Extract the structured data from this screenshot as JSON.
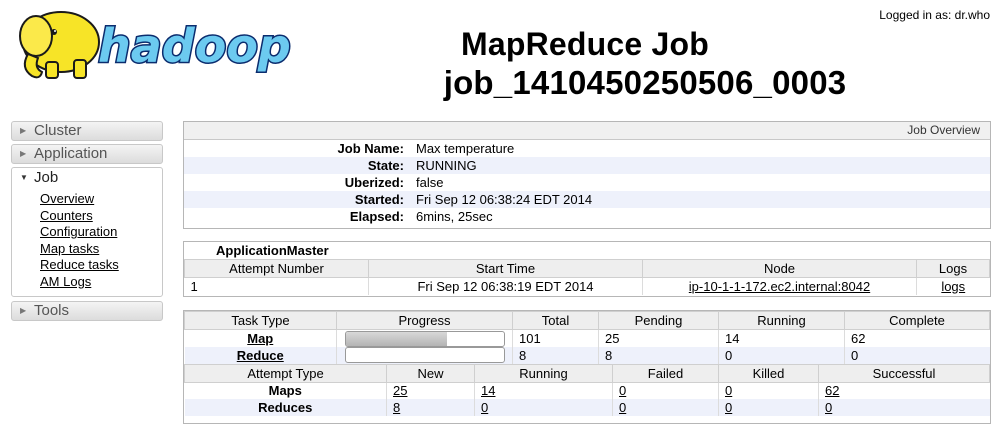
{
  "header": {
    "logged_in": "Logged in as: dr.who",
    "title_line1": "MapReduce Job",
    "title_line2": "job_1410450250506_0003",
    "logo_text": "hadoop"
  },
  "sidebar": {
    "cluster": "Cluster",
    "application": "Application",
    "job": "Job",
    "job_links": [
      "Overview",
      "Counters",
      "Configuration",
      "Map tasks",
      "Reduce tasks",
      "AM Logs"
    ],
    "tools": "Tools"
  },
  "job_overview": {
    "caption": "Job Overview",
    "rows": [
      {
        "label": "Job Name:",
        "value": "Max temperature"
      },
      {
        "label": "State:",
        "value": "RUNNING"
      },
      {
        "label": "Uberized:",
        "value": "false"
      },
      {
        "label": "Started:",
        "value": "Fri Sep 12 06:38:24 EDT 2014"
      },
      {
        "label": "Elapsed:",
        "value": "6mins, 25sec"
      }
    ]
  },
  "app_master": {
    "caption": "ApplicationMaster",
    "headers": [
      "Attempt Number",
      "Start Time",
      "Node",
      "Logs"
    ],
    "row": {
      "attempt": "1",
      "start_time": "Fri Sep 12 06:38:19 EDT 2014",
      "node": "ip-10-1-1-172.ec2.internal:8042",
      "logs": "logs"
    }
  },
  "tasks": {
    "headers": [
      "Task Type",
      "Progress",
      "Total",
      "Pending",
      "Running",
      "Complete"
    ],
    "rows": [
      {
        "type": "Map",
        "progress": 0.64,
        "total": "101",
        "pending": "25",
        "running": "14",
        "complete": "62"
      },
      {
        "type": "Reduce",
        "progress": 0,
        "total": "8",
        "pending": "8",
        "running": "0",
        "complete": "0"
      }
    ]
  },
  "attempts": {
    "headers": [
      "Attempt Type",
      "New",
      "Running",
      "Failed",
      "Killed",
      "Successful"
    ],
    "rows": [
      {
        "type": "Maps",
        "new": "25",
        "running": "14",
        "failed": "0",
        "killed": "0",
        "successful": "62"
      },
      {
        "type": "Reduces",
        "new": "8",
        "running": "0",
        "failed": "0",
        "killed": "0",
        "successful": "0"
      }
    ]
  }
}
